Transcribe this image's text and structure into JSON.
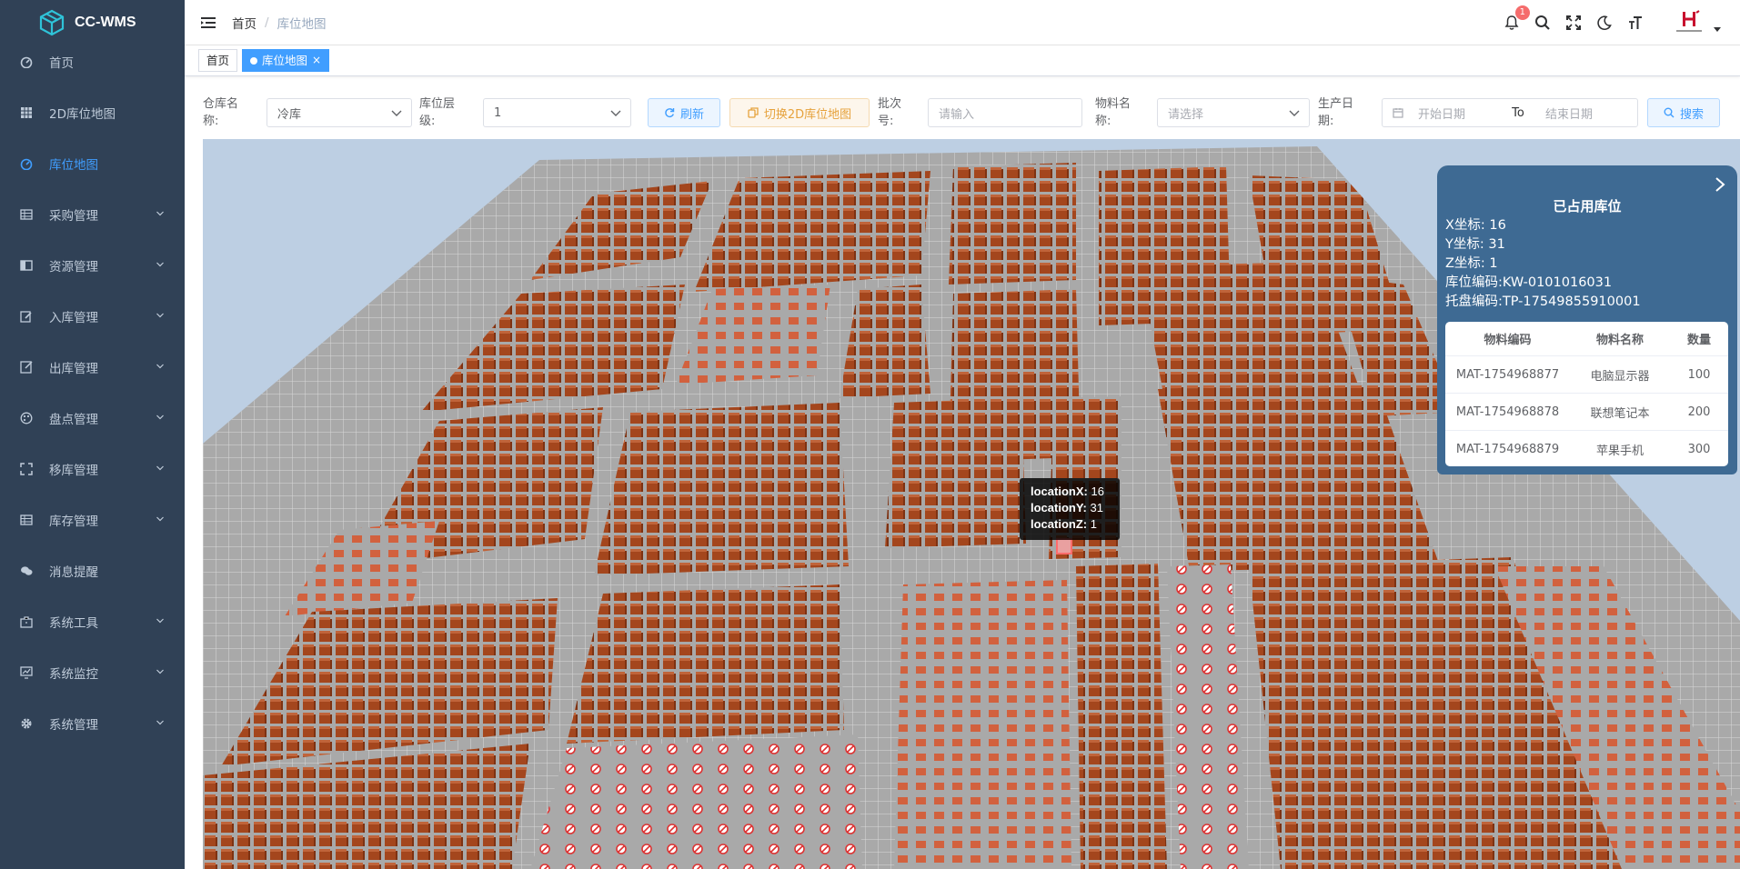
{
  "app": {
    "title": "CC-WMS"
  },
  "sidebar": {
    "items": [
      {
        "label": "首页",
        "icon": "dashboard-icon",
        "has_children": false,
        "active": false
      },
      {
        "label": "2D库位地图",
        "icon": "grid-icon",
        "has_children": false,
        "active": false
      },
      {
        "label": "库位地图",
        "icon": "dashboard-icon",
        "has_children": false,
        "active": true
      },
      {
        "label": "采购管理",
        "icon": "table-icon",
        "has_children": true,
        "active": false
      },
      {
        "label": "资源管理",
        "icon": "book-icon",
        "has_children": true,
        "active": false
      },
      {
        "label": "入库管理",
        "icon": "edit-icon",
        "has_children": true,
        "active": false
      },
      {
        "label": "出库管理",
        "icon": "form-icon",
        "has_children": true,
        "active": false
      },
      {
        "label": "盘点管理",
        "icon": "palette-icon",
        "has_children": true,
        "active": false
      },
      {
        "label": "移库管理",
        "icon": "fullscreen-icon",
        "has_children": true,
        "active": false
      },
      {
        "label": "库存管理",
        "icon": "table-icon",
        "has_children": true,
        "active": false
      },
      {
        "label": "消息提醒",
        "icon": "wechat-icon",
        "has_children": false,
        "active": false
      },
      {
        "label": "系统工具",
        "icon": "toolbox-icon",
        "has_children": true,
        "active": false
      },
      {
        "label": "系统监控",
        "icon": "monitor-icon",
        "has_children": true,
        "active": false
      },
      {
        "label": "系统管理",
        "icon": "gear-icon",
        "has_children": true,
        "active": false
      }
    ]
  },
  "navbar": {
    "breadcrumb": {
      "home": "首页",
      "separator": "/",
      "current": "库位地图"
    },
    "notification_count": "1"
  },
  "tags": {
    "home": "首页",
    "current": "库位地图",
    "close": "×"
  },
  "filters": {
    "warehouse_label": "仓库名称:",
    "warehouse_value": "冷库",
    "level_label": "库位层级:",
    "level_value": "1",
    "refresh_label": "刷新",
    "switch_label": "切换2D库位地图",
    "batch_label": "批次号:",
    "batch_placeholder": "请输入",
    "material_label": "物料名称:",
    "material_placeholder": "请选择",
    "date_label": "生产日期:",
    "date_start_placeholder": "开始日期",
    "date_to": "To",
    "date_end_placeholder": "结束日期",
    "search_label": "搜索"
  },
  "tooltip": {
    "x_key": "locationX:",
    "x_val": "16",
    "y_key": "locationY:",
    "y_val": "31",
    "z_key": "locationZ:",
    "z_val": "1"
  },
  "panel": {
    "title": "已占用库位",
    "x_line": "X坐标:  16",
    "y_line": "Y坐标:  31",
    "z_line": "Z坐标:  1",
    "loc_line": "库位编码:KW-0101016031",
    "pallet_line": "托盘编码:TP-17549855910001",
    "table": {
      "headers": [
        "物料编码",
        "物料名称",
        "数量"
      ],
      "rows": [
        [
          "MAT-1754968877",
          "电脑显示器",
          "100"
        ],
        [
          "MAT-1754968878",
          "联想笔记本",
          "200"
        ],
        [
          "MAT-1754968879",
          "苹果手机",
          "300"
        ]
      ]
    }
  },
  "colors": {
    "sidebar_bg": "#304156",
    "accent": "#409eff",
    "floor": "#a9a9a9",
    "box": "#a4461d",
    "panel_bg": "#3e6a93"
  }
}
